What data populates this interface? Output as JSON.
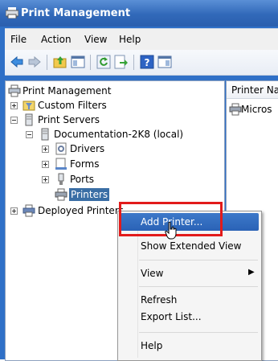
{
  "window": {
    "title": "Print Management"
  },
  "menubar": {
    "items": [
      "File",
      "Action",
      "View",
      "Help"
    ]
  },
  "tree": {
    "nodes": [
      {
        "label": "Print Management"
      },
      {
        "label": "Custom Filters"
      },
      {
        "label": "Print Servers"
      },
      {
        "label": "Documentation-2K8 (local)"
      },
      {
        "label": "Drivers"
      },
      {
        "label": "Forms"
      },
      {
        "label": "Ports"
      },
      {
        "label": "Printers"
      },
      {
        "label": "Deployed Printers"
      }
    ]
  },
  "right_pane": {
    "column_header": "Printer Na",
    "rows": [
      {
        "label": "Micros"
      }
    ]
  },
  "context_menu": {
    "items": [
      {
        "label": "Add Printer..."
      },
      {
        "label": "Show Extended View"
      },
      {
        "label": "View"
      },
      {
        "label": "Refresh"
      },
      {
        "label": "Export List..."
      },
      {
        "label": "Help"
      }
    ]
  },
  "colors": {
    "title_blue": "#3169b9",
    "highlight": "#2a62b6",
    "callout_red": "#e21b1b"
  },
  "icons": [
    "print-management-icon",
    "back-arrow-icon",
    "forward-arrow-icon",
    "folder-up-icon",
    "show-hide-tree-icon",
    "refresh-icon",
    "export-icon",
    "help-icon",
    "properties-icon",
    "printer-icon",
    "server-icon",
    "filter-icon",
    "drivers-icon",
    "forms-icon",
    "ports-icon"
  ]
}
